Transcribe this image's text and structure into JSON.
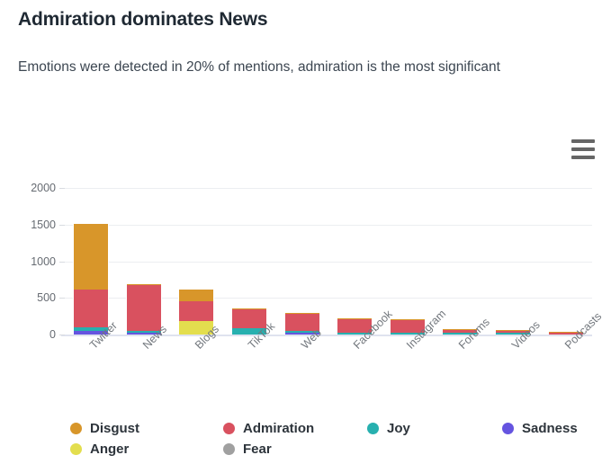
{
  "header": {
    "title": "Admiration dominates News",
    "subtitle": "Emotions were detected in 20% of mentions, admiration is the most significant"
  },
  "toolbar": {
    "menu_icon": "hamburger-menu-icon"
  },
  "chart_data": {
    "type": "bar",
    "stacked": true,
    "title": "Admiration dominates News",
    "subtitle": "Emotions were detected in 20% of mentions, admiration is the most significant",
    "xlabel": "",
    "ylabel": "",
    "ylim": [
      0,
      2000
    ],
    "yticks": [
      0,
      500,
      1000,
      1500,
      2000
    ],
    "ytick_labels": [
      "0",
      "500",
      "1000",
      "1500",
      "2000"
    ],
    "grid": true,
    "legend_position": "bottom",
    "categories": [
      "Twitter",
      "News",
      "Blogs",
      "TikTok",
      "Web",
      "Facebook",
      "Instagram",
      "Forums",
      "Videos",
      "Podcasts"
    ],
    "series": [
      {
        "name": "Disgust",
        "color": "#D8962A",
        "values": [
          900,
          22,
          175,
          20,
          6,
          4,
          4,
          14,
          2,
          1
        ]
      },
      {
        "name": "Admiration",
        "color": "#D9515F",
        "values": [
          520,
          620,
          265,
          255,
          230,
          180,
          170,
          42,
          26,
          3
        ]
      },
      {
        "name": "Joy",
        "color": "#27B0AF",
        "values": [
          55,
          18,
          0,
          90,
          6,
          2,
          22,
          10,
          2,
          0
        ]
      },
      {
        "name": "Sadness",
        "color": "#6554E0",
        "values": [
          45,
          5,
          0,
          0,
          2,
          0,
          0,
          0,
          0,
          0
        ]
      },
      {
        "name": "Anger",
        "color": "#E3DE4E",
        "values": [
          0,
          0,
          185,
          0,
          0,
          0,
          0,
          0,
          0,
          0
        ]
      },
      {
        "name": "Fear",
        "color": "#A0A0A0",
        "values": [
          0,
          0,
          0,
          0,
          0,
          0,
          0,
          0,
          0,
          0
        ]
      }
    ],
    "totals": [
      1520,
      665,
      625,
      365,
      244,
      186,
      196,
      66,
      30,
      4
    ]
  },
  "legend": [
    {
      "label": "Disgust",
      "color": "#D8962A"
    },
    {
      "label": "Admiration",
      "color": "#D9515F"
    },
    {
      "label": "Joy",
      "color": "#27B0AF"
    },
    {
      "label": "Sadness",
      "color": "#6554E0"
    },
    {
      "label": "Anger",
      "color": "#E3DE4E"
    },
    {
      "label": "Fear",
      "color": "#A0A0A0"
    }
  ]
}
